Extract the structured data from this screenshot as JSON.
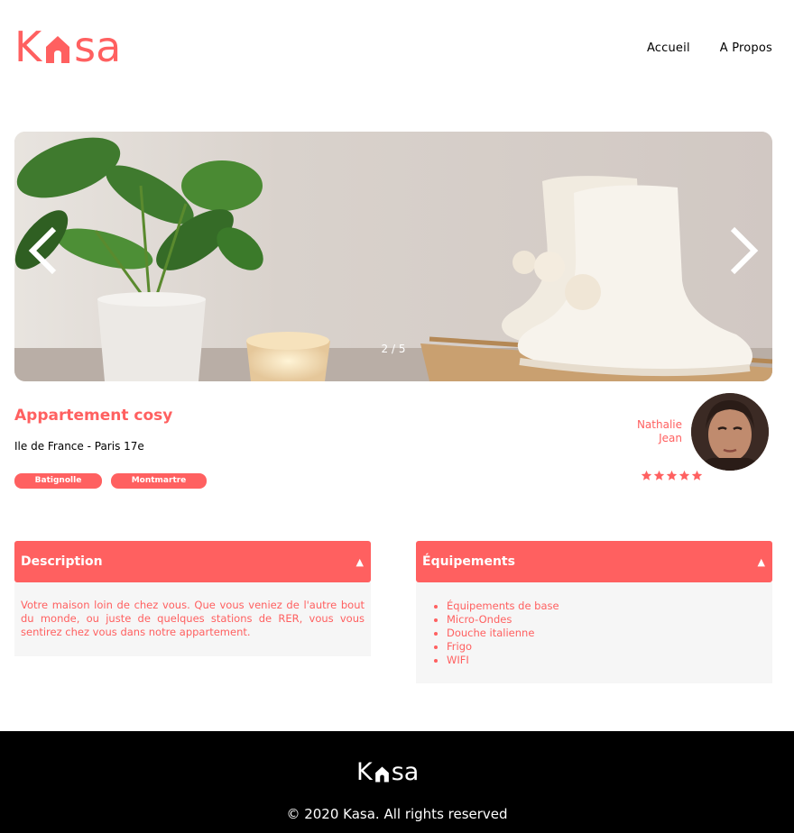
{
  "header": {
    "logo_letters": [
      "K",
      "sa"
    ],
    "nav": [
      {
        "label": "Accueil"
      },
      {
        "label": "A Propos"
      }
    ]
  },
  "carousel": {
    "counter": "2 / 5",
    "current": 2,
    "total": 5
  },
  "listing": {
    "title": "Appartement cosy",
    "location": "Ile de France - Paris 17e",
    "tags": [
      "Batignolle",
      "Montmartre"
    ],
    "rating": 5,
    "rating_max": 5
  },
  "host": {
    "first_name": "Nathalie",
    "last_name": "Jean"
  },
  "collapses": {
    "description": {
      "title": "Description",
      "text": "Votre maison loin de chez vous. Que vous veniez de l'autre bout du monde, ou juste de quelques stations de RER, vous vous sentirez chez vous dans notre appartement."
    },
    "equipments": {
      "title": "Équipements",
      "items": [
        "Équipements de base",
        "Micro-Ondes",
        "Douche italienne",
        "Frigo",
        "WIFI"
      ]
    }
  },
  "footer": {
    "copyright": "© 2020 Kasa. All rights reserved"
  },
  "colors": {
    "brand": "#FF6060",
    "panel": "#F6F6F6",
    "footer": "#000000"
  },
  "icons": [
    "house-icon",
    "chevron-left-icon",
    "chevron-right-icon",
    "chevron-up-icon",
    "star-icon"
  ]
}
